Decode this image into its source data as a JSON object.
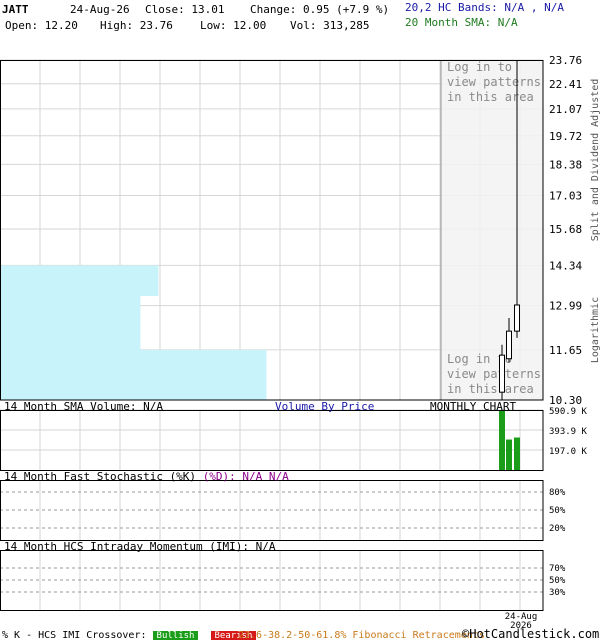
{
  "header": {
    "symbol": "JATT",
    "date": "24-Aug-26",
    "close_label": "Close: 13.01",
    "change_label": "Change: 0.95 (+7.9 %)",
    "open_label": "Open: 12.20",
    "high_label": "High: 23.76",
    "low_label": "Low: 12.00",
    "vol_label": "Vol: 313,285",
    "bands_label": "20,2 HC Bands: N/A , N/A",
    "sma_label": "20 Month SMA: N/A"
  },
  "overlay": {
    "login_line1": "Log in to",
    "login_line2": "view patterns",
    "login_line3": "in this area"
  },
  "side_label_top": "Split and Dividend Adjusted",
  "side_label_bottom": "Logarithmic",
  "panels": {
    "volume_label": "14 Month SMA Volume: N/A",
    "vbp_label": "Volume By Price",
    "monthly_label": "MONTHLY CHART",
    "stoch_label": "14 Month Fast Stochastic (%K)",
    "stoch_d_label": "(%D): N/A",
    "stoch_d_value": "N/A",
    "imi_label": "14 Month HCS Intraday Momentum (IMI): N/A"
  },
  "footer": {
    "legend_prefix": "% K - HCS IMI Crossover:",
    "bullish": "Bullish",
    "bearish": "Bearish",
    "fib": "23.6-38.2-50-61.8% Fibonacci Retracements",
    "copyright": "©HotCandlestick.com",
    "date_line1": "24-Aug",
    "date_line2": "2026"
  },
  "colors": {
    "vbp_fill": "#c8f3fb",
    "volume_bar": "#1a9e1a",
    "grid": "#d6d6d6",
    "bullish_bg": "#1a9e1a",
    "bearish_bg": "#d61a1a",
    "fib_text": "#c87a1a",
    "overlay_bg": "#f2f2f2"
  },
  "chart_data": {
    "type": "candlestick",
    "price_scale": "log",
    "price_ticks": [
      23.76,
      22.41,
      21.07,
      19.72,
      18.38,
      17.03,
      15.68,
      14.34,
      12.99,
      11.65,
      10.3
    ],
    "ylim": [
      10.3,
      23.76
    ],
    "candles": [
      {
        "open": 10.5,
        "high": 11.8,
        "low": 10.3,
        "close": 11.5
      },
      {
        "open": 11.4,
        "high": 12.6,
        "low": 11.3,
        "close": 12.2
      },
      {
        "open": 12.2,
        "high": 23.76,
        "low": 12.0,
        "close": 13.01
      }
    ],
    "volume_ticks": [
      "590.9 K",
      "393.9 K",
      "197.0 K"
    ],
    "volume_ticks_values": [
      590.9,
      393.9,
      197.0
    ],
    "volume_values": [
      590.9,
      300.0,
      320.0
    ],
    "volume_by_price": [
      {
        "low": 13.3,
        "high": 14.34,
        "fraction": 0.44
      },
      {
        "low": 11.65,
        "high": 13.3,
        "fraction": 0.39
      },
      {
        "low": 10.3,
        "high": 11.65,
        "fraction": 0.74
      }
    ],
    "stoch_ticks": [
      "80%",
      "50%",
      "20%"
    ],
    "imi_ticks": [
      "70%",
      "50%",
      "30%"
    ]
  }
}
